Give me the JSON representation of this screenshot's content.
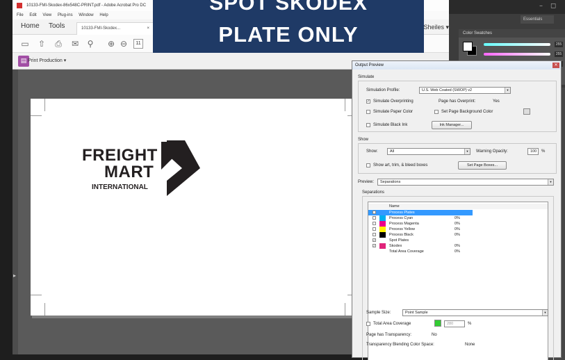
{
  "banner": {
    "line1": "SPOT SKODEX",
    "line2": "PLATE ONLY"
  },
  "acrobat": {
    "title": "10133-FMI-Skodex-86x548C-PRINT.pdf - Adobe Acrobat Pro DC",
    "menu": [
      "File",
      "Edit",
      "View",
      "Plug-ins",
      "Window",
      "Help"
    ],
    "tabs": {
      "home": "Home",
      "tools": "Tools",
      "doc": "10133-FMI-Skodex..."
    },
    "user": "Sheiles",
    "page_num": "11",
    "print_production": "Print Production"
  },
  "photoshop": {
    "essentials": "Essentials",
    "panel_tabs": "Color    Swatches",
    "slider_values": [
      "255",
      "255",
      "255"
    ]
  },
  "logo": {
    "line1": "FREIGHT",
    "line2": "MART",
    "line3": "INTERNATIONAL"
  },
  "dialog": {
    "title": "Output Preview",
    "simulate_label": "Simulate",
    "sim_profile_label": "Simulation Profile:",
    "sim_profile_value": "U.S. Web Coated (SWOP) v2",
    "simulate_overprinting": "Simulate Overprinting",
    "page_has_overprint_label": "Page has Overprint:",
    "page_has_overprint_value": "Yes",
    "simulate_paper_color": "Simulate Paper Color",
    "set_page_bg": "Set Page Background Color",
    "simulate_black_ink": "Simulate Black Ink",
    "ink_manager": "Ink Manager...",
    "show_label": "Show",
    "show_field_label": "Show:",
    "show_value": "All",
    "warning_opacity_label": "Warning Opacity:",
    "warning_opacity_value": "100",
    "pct": "%",
    "show_boxes": "Show art, trim, & bleed boxes",
    "set_page_boxes": "Set Page Boxes...",
    "preview_label": "Preview:",
    "preview_value": "Separations",
    "separations_label": "Separations",
    "col_name": "Name",
    "rows": [
      {
        "name": "Process Plates",
        "pct": "",
        "color": "",
        "checked": false
      },
      {
        "name": "Process Cyan",
        "pct": "0%",
        "color": "#00aeef",
        "checked": false
      },
      {
        "name": "Process Magenta",
        "pct": "0%",
        "color": "#ec008c",
        "checked": false
      },
      {
        "name": "Process Yellow",
        "pct": "0%",
        "color": "#fff200",
        "checked": false
      },
      {
        "name": "Process Black",
        "pct": "0%",
        "color": "#000000",
        "checked": false
      },
      {
        "name": "Spot Plates",
        "pct": "",
        "color": "",
        "checked": true
      },
      {
        "name": "Skodex",
        "pct": "0%",
        "color": "#e0247a",
        "checked": true
      },
      {
        "name": "Total Area Coverage",
        "pct": "0%",
        "color": "",
        "checked": false
      }
    ],
    "sample_size_label": "Sample Size:",
    "sample_size_value": "Point Sample",
    "total_area_coverage": "Total Area Coverage",
    "tac_value": "280",
    "page_has_transparency_label": "Page has Transparency:",
    "page_has_transparency_value": "No",
    "transparency_blending_label": "Transparency Blending Color Space:",
    "transparency_blending_value": "None"
  },
  "colors": {
    "banner": "#1f3a66",
    "print_prod": "#a24fa5",
    "highlight": "#3399ff",
    "tac_green": "#33cc33"
  }
}
